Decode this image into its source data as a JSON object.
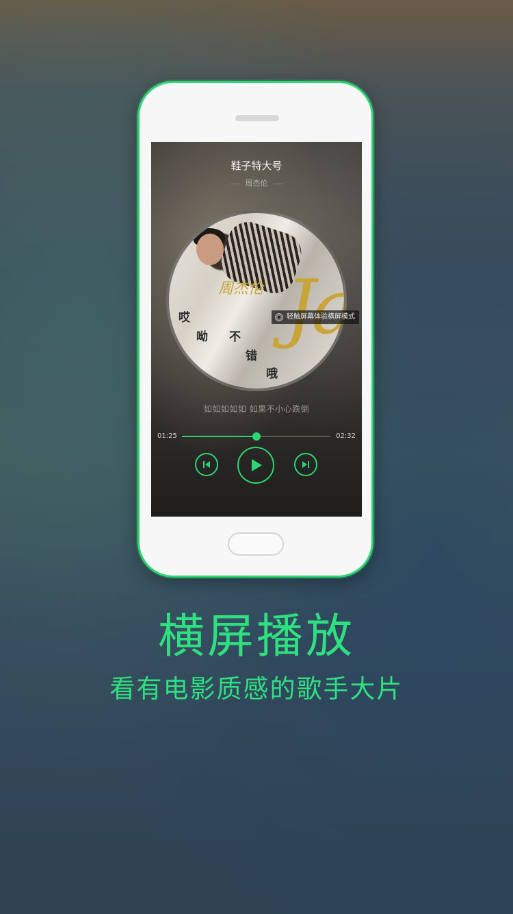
{
  "player": {
    "song_title": "鞋子特大号",
    "artist": "周杰伦",
    "landscape_tip": "轻触屏幕体验横屏模式",
    "lyric": "如如如如如  如果不小心跌倒",
    "current_time": "01:25",
    "total_time": "02:32",
    "progress": 0.5,
    "album_art_text": {
      "jay": "Jay",
      "name": "周杰伦",
      "title_chars": [
        "哎",
        "呦",
        "不",
        "错",
        "哦"
      ]
    }
  },
  "promo": {
    "headline": "横屏播放",
    "subline": "看有电影质感的歌手大片"
  },
  "colors": {
    "accent": "#2ed573",
    "frame": "#2ed573"
  }
}
